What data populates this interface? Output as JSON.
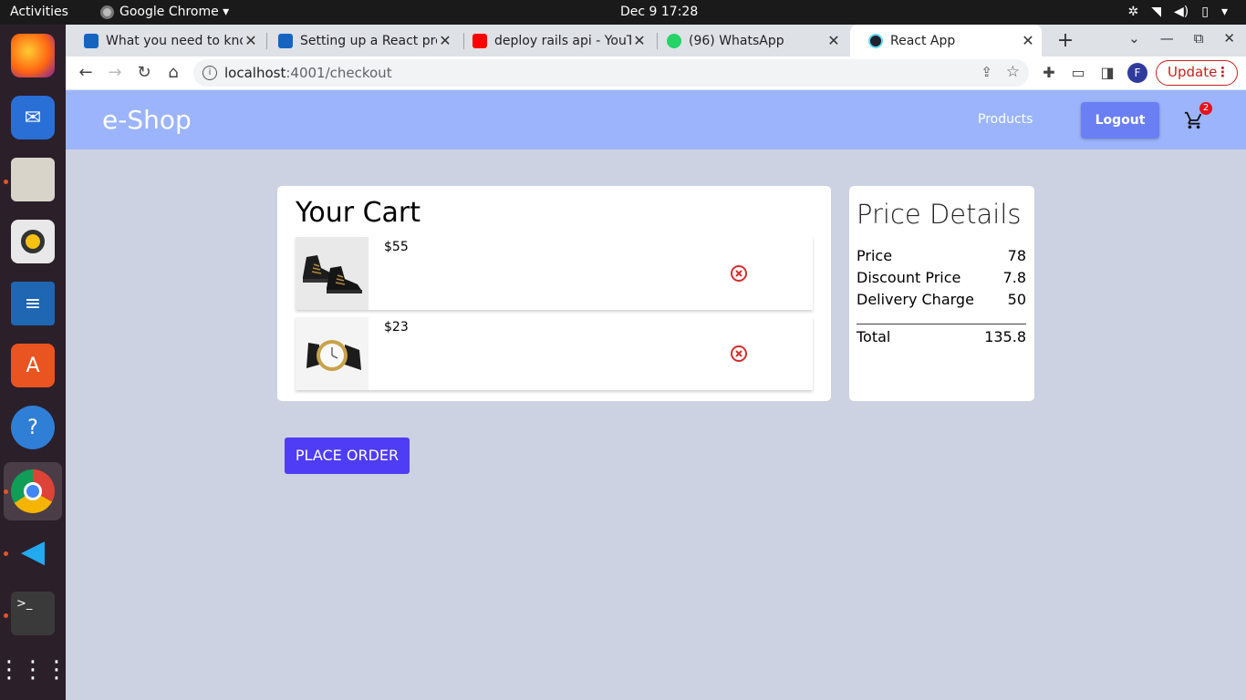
{
  "system_bar": {
    "activities": "Activities",
    "app_name": "Google Chrome ▾",
    "clock": "Dec 9  17:28"
  },
  "browser": {
    "tabs": [
      {
        "title": "What you need to kno",
        "favicon_color": "#1565c0",
        "active": false
      },
      {
        "title": "Setting up a React pro",
        "favicon_color": "#1565c0",
        "active": false
      },
      {
        "title": "deploy rails api - YouTu",
        "favicon_color": "#ff0000",
        "active": false
      },
      {
        "title": "(96) WhatsApp",
        "favicon_color": "#25d366",
        "active": false
      },
      {
        "title": "React App",
        "favicon_color": "#61dafb",
        "active": true
      }
    ],
    "url_host": "localhost",
    "url_path": ":4001/checkout",
    "profile_initial": "F",
    "update_label": "Update"
  },
  "app": {
    "brand": "e-Shop",
    "nav": {
      "products": "Products",
      "logout": "Logout",
      "cart_count": "2"
    },
    "cart": {
      "title": "Your Cart",
      "items": [
        {
          "price": "$55",
          "image": "black high-top sneakers"
        },
        {
          "price": "$23",
          "image": "gold wristwatch"
        }
      ]
    },
    "price_details": {
      "title": "Price Details",
      "price_label": "Price",
      "price_value": "78",
      "discount_label": "Discount Price",
      "discount_value": "7.8",
      "delivery_label": "Delivery Charge",
      "delivery_value": "50",
      "total_label": "Total",
      "total_value": "135.8"
    },
    "place_order": "PLACE ORDER"
  },
  "colors": {
    "navbar": "#9bb4fc",
    "logout_button": "#6b7ff5",
    "place_order_button": "#4f3cf5",
    "page_background": "#cdd2e2",
    "remove_icon": "#d32f2f"
  }
}
